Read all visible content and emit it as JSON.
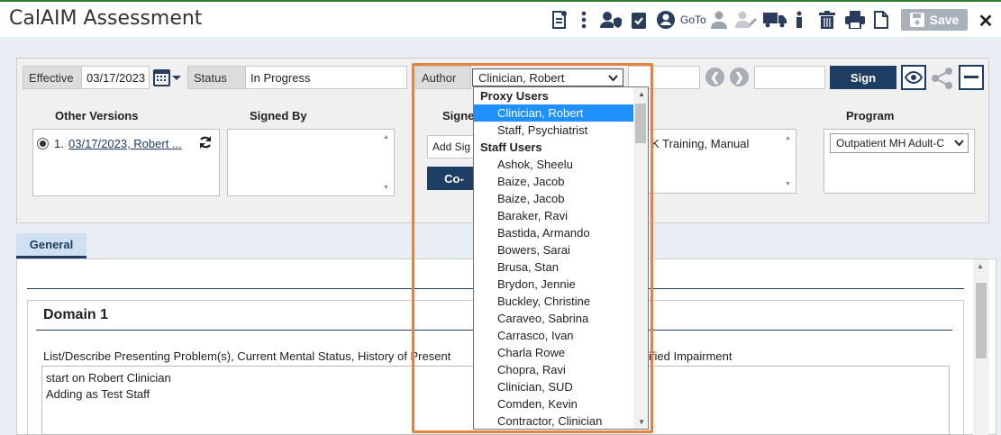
{
  "window": {
    "title": "CalAIM Assessment"
  },
  "toolbar": {
    "goto_label": "GoTo",
    "save_label": "Save",
    "close_label": "✕"
  },
  "header": {
    "effective_label": "Effective",
    "effective_value": "03/17/2023",
    "status_label": "Status",
    "status_value": "In Progress",
    "author_label": "Author",
    "author_value": "Clinician, Robert",
    "sign_label": "Sign"
  },
  "columns": {
    "other_versions": "Other Versions",
    "signed_by": "Signed By",
    "signers_partial": "Signe",
    "program": "Program"
  },
  "versions": [
    {
      "label": "1.",
      "link": "03/17/2023, Robert ..."
    }
  ],
  "signers": {
    "add_placeholder": "Add Sig",
    "cosign_partial": "Co-",
    "trainee_partial": "K Training, Manual"
  },
  "program": {
    "value": "Outpatient MH Adult-C"
  },
  "tabs": [
    {
      "label": "General"
    }
  ],
  "domain": {
    "title": "Domain 1",
    "prompt_left": "List/Describe Presenting Problem(s), Current Mental Status, History of Present",
    "prompt_right": "ified Impairment",
    "text_lines": [
      "start on Robert Clinician",
      "Adding as Test Staff"
    ]
  },
  "author_dropdown": {
    "groups": [
      {
        "name": "Proxy Users",
        "items": [
          "Clinician, Robert",
          "Staff, Psychiatrist"
        ]
      },
      {
        "name": "Staff Users",
        "items": [
          "Ashok, Sheelu",
          "Baize, Jacob",
          "Baize, Jacob",
          "Baraker, Ravi",
          "Bastida, Armando",
          "Bowers, Sarai",
          "Brusa, Stan",
          "Brydon, Jennie",
          "Buckley, Christine",
          "Caraveo, Sabrina",
          "Carrasco, Ivan",
          "Charla Rowe",
          "Chopra, Ravi",
          "Clinician, SUD",
          "Comden, Kevin",
          "Contractor, Clinician"
        ]
      }
    ],
    "selected": "Clinician, Robert"
  },
  "colors": {
    "navy": "#1e3d63",
    "highlight": "#e8803f",
    "selection": "#1e90ff"
  }
}
